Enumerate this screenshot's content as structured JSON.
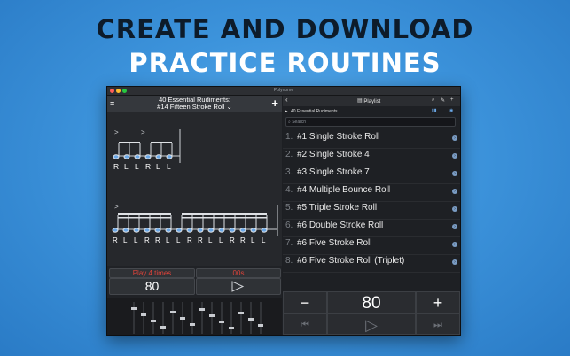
{
  "banner": {
    "line1": "CREATE AND DOWNLOAD",
    "line2": "PRACTICE ROUTINES"
  },
  "window": {
    "title": "Polynome"
  },
  "left": {
    "title_line1": "40 Essential Rudiments:",
    "title_line2": "#14 Fifteen Stroke Roll",
    "title_chevron": "⌄",
    "menu_icon": "≡",
    "add_icon": "+",
    "notation": {
      "staff1_sticking": [
        "R",
        "L",
        "L",
        "R",
        "L",
        "L"
      ],
      "staff2_sticking": [
        "R",
        "L",
        "L",
        "R",
        "R",
        "L",
        "L",
        "R",
        "R",
        "L",
        "L",
        "R",
        "R",
        "L",
        "L"
      ]
    },
    "play_count": "Play 4 times",
    "timer": "00s",
    "tempo": "80",
    "colors": {
      "accent_red": "#e0433a",
      "note_blue": "#6aa7e6"
    }
  },
  "right": {
    "header": {
      "back_icon": "‹",
      "view_label": "Playlist",
      "icons": [
        "search-icon",
        "edit-icon",
        "add-icon"
      ]
    },
    "breadcrumb": "40 Essential Rudiments",
    "search_placeholder": "Search",
    "items": [
      {
        "num": "1.",
        "name": "#1 Single Stroke Roll"
      },
      {
        "num": "2.",
        "name": "#2 Single Stroke 4"
      },
      {
        "num": "3.",
        "name": "#3 Single Stroke 7"
      },
      {
        "num": "4.",
        "name": "#4 Multiple Bounce Roll"
      },
      {
        "num": "5.",
        "name": "#5 Triple Stroke Roll"
      },
      {
        "num": "6.",
        "name": "#6 Double Stroke Roll"
      },
      {
        "num": "7.",
        "name": "#6 Five Stroke Roll"
      },
      {
        "num": "8.",
        "name": "#6 Five Stroke Roll (Triplet)"
      }
    ],
    "controls": {
      "minus": "−",
      "tempo": "80",
      "plus": "+",
      "prev": "⏮",
      "play": "▷",
      "next": "⏭"
    }
  }
}
